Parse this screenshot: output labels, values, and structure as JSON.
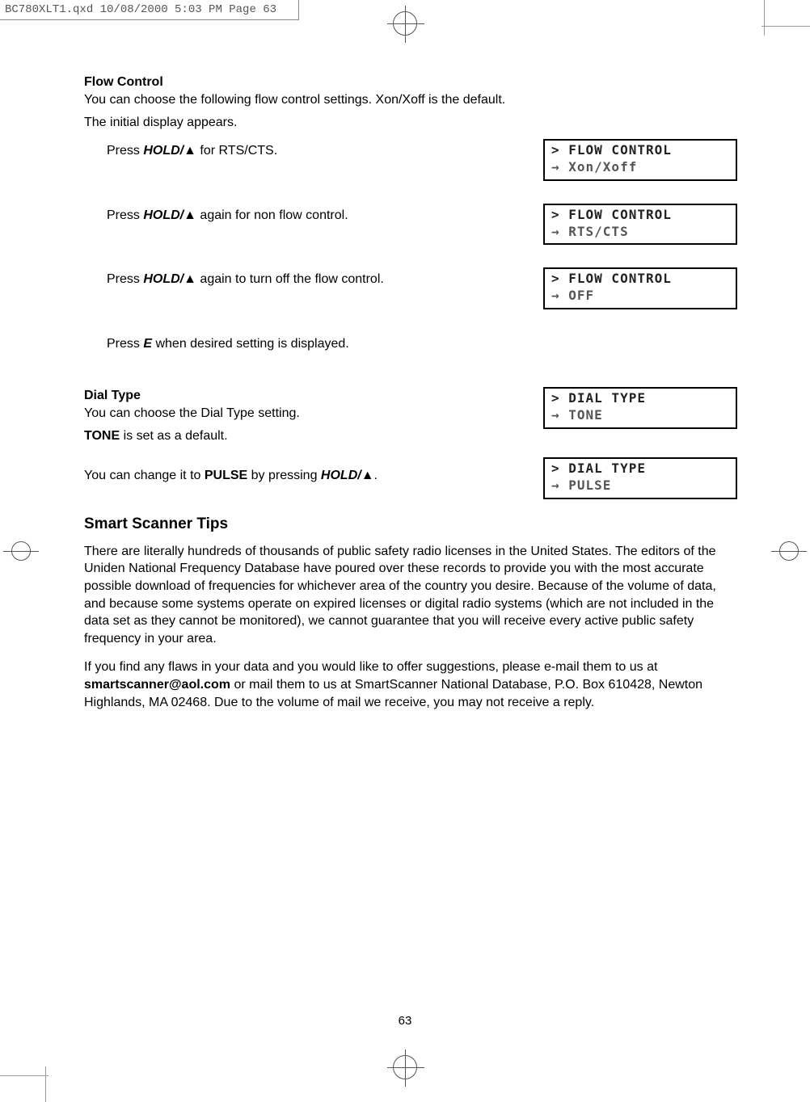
{
  "header": "BC780XLT1.qxd  10/08/2000  5:03 PM  Page 63",
  "flow": {
    "heading": "Flow Control",
    "intro1": "You can choose the following flow control settings. Xon/Xoff is the default.",
    "intro2": "The initial display appears.",
    "step1_pre": "Press ",
    "step1_hold": "HOLD/",
    "step1_post": " for RTS/CTS.",
    "step2_pre": "Press ",
    "step2_hold": "HOLD/",
    "step2_post": " again for non flow control.",
    "step3_pre": "Press ",
    "step3_hold": "HOLD/",
    "step3_post": " again to turn off the flow control.",
    "step4_pre": "Press ",
    "step4_e": "E",
    "step4_post": " when desired setting is displayed."
  },
  "lcd1": {
    "l1": "> FLOW CONTROL",
    "l2": "→ Xon/Xoff"
  },
  "lcd2": {
    "l1": "> FLOW CONTROL",
    "l2": "→ RTS/CTS"
  },
  "lcd3": {
    "l1": "> FLOW CONTROL",
    "l2": "→ OFF"
  },
  "dial": {
    "heading": "Dial Type",
    "line1": "You can choose the Dial Type setting.",
    "line2_pre": "",
    "line2_bold": "TONE",
    "line2_post": " is set as a default.",
    "line3_pre": "You can change it to ",
    "line3_bold": "PULSE",
    "line3_mid": " by pressing ",
    "line3_hold": "HOLD/",
    "line3_post": "."
  },
  "lcd4": {
    "l1": "> DIAL TYPE",
    "l2": "→ TONE"
  },
  "lcd5": {
    "l1": "> DIAL TYPE",
    "l2": "→ PULSE"
  },
  "tips": {
    "heading": "Smart Scanner Tips",
    "para1": "There are literally hundreds of thousands of public safety radio licenses in the United States. The editors of the Uniden National Frequency Database have poured over these records to provide you with the most accurate possible download of frequencies for whichever area of the country you desire. Because of the volume of data, and because some systems operate on expired licenses or digital radio systems (which are not included in the data set as they cannot be monitored), we cannot guarantee that you will receive every active public safety frequency in your area.",
    "para2_pre": "If you find any flaws in your data and you would like to offer suggestions, please e-mail them to us at ",
    "para2_email": "smartscanner@aol.com",
    "para2_post": " or mail them to us at SmartScanner National Database, P.O. Box 610428, Newton Highlands, MA 02468. Due to the volume of mail we receive, you may not receive a reply."
  },
  "page_number": "63"
}
